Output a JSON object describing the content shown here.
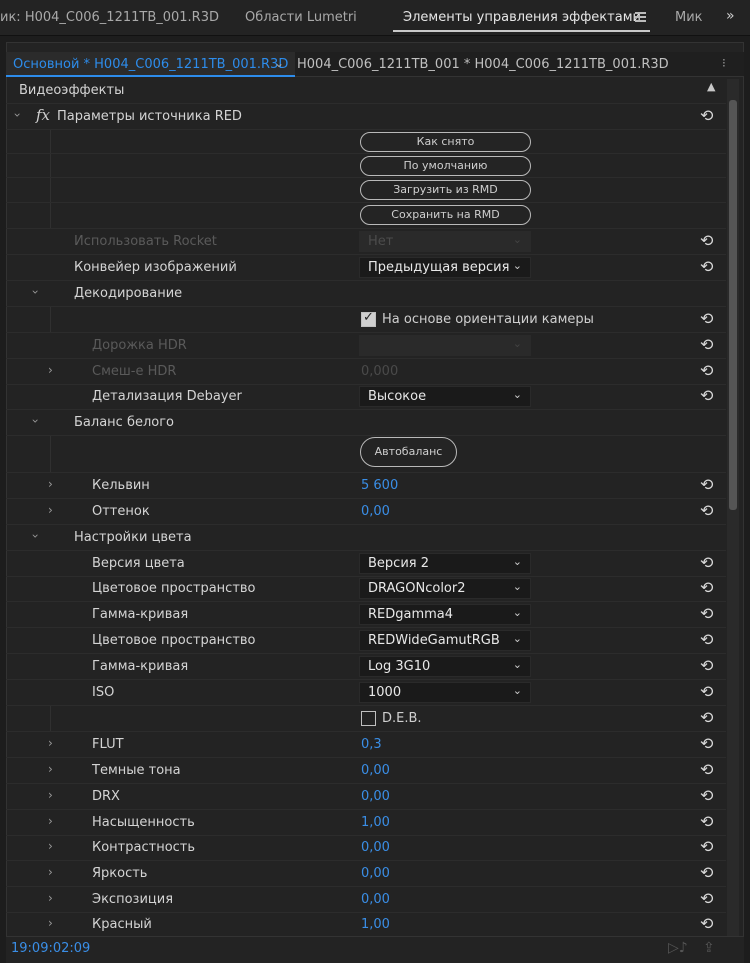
{
  "tabs": {
    "source": "ик: H004_C006_1211TB_001.R3D",
    "lumetri": "Области Lumetri",
    "effect_controls": "Элементы управления эффектами",
    "mixer": "Мик",
    "overflow": "»"
  },
  "clipbar": {
    "master": "Основной * H004_C006_1211TB_001.R3D",
    "chevron": "⌄",
    "sequence_clip": "H004_C006_1211TB_001 * H004_C006_1211TB_001.R3D"
  },
  "video_effects_header": "Видеоэффекты",
  "red_source": {
    "fx": "fx",
    "title": "Параметры источника RED",
    "buttons": [
      "Как снято",
      "По умолчанию",
      "Загрузить из RMD",
      "Сохранить на RMD"
    ],
    "use_rocket": {
      "label": "Использовать Rocket",
      "value": "Нет"
    },
    "pipeline": {
      "label": "Конвейер изображений",
      "value": "Предыдущая версия"
    },
    "decode": {
      "title": "Декодирование",
      "camera_orientation": {
        "label": "На основе ориентации камеры",
        "checked": true
      },
      "hdr_track": {
        "label": "Дорожка HDR",
        "value": ""
      },
      "hdr_blend": {
        "label": "Смеш-е HDR",
        "value": "0,000"
      },
      "debayer": {
        "label": "Детализация Debayer",
        "value": "Высокое"
      }
    },
    "white_balance": {
      "title": "Баланс белого",
      "auto_button": "Автобаланс",
      "kelvin": {
        "label": "Кельвин",
        "value": "5 600"
      },
      "tint": {
        "label": "Оттенок",
        "value": "0,00"
      }
    },
    "color_settings": {
      "title": "Настройки цвета",
      "color_version": {
        "label": "Версия цвета",
        "value": "Версия 2"
      },
      "color_space_1": {
        "label": "Цветовое пространство",
        "value": "DRAGONcolor2"
      },
      "gamma_1": {
        "label": "Гамма-кривая",
        "value": "REDgamma4"
      },
      "color_space_2": {
        "label": "Цветовое пространство",
        "value": "REDWideGamutRGB"
      },
      "gamma_2": {
        "label": "Гамма-кривая",
        "value": "Log 3G10"
      },
      "iso": {
        "label": "ISO",
        "value": "1000"
      },
      "deb": {
        "label": "D.E.B.",
        "checked": false
      },
      "flut": {
        "label": "FLUT",
        "value": "0,3"
      },
      "shadows": {
        "label": "Темные тона",
        "value": "0,00"
      },
      "drx": {
        "label": "DRX",
        "value": "0,00"
      },
      "saturation": {
        "label": "Насыщенность",
        "value": "1,00"
      },
      "contrast": {
        "label": "Контрастность",
        "value": "0,00"
      },
      "brightness": {
        "label": "Яркость",
        "value": "0,00"
      },
      "exposure": {
        "label": "Экспозиция",
        "value": "0,00"
      },
      "red": {
        "label": "Красный",
        "value": "1,00"
      }
    }
  },
  "footer": {
    "timecode": "19:09:02:09"
  },
  "icons": {
    "reset": "reset-icon",
    "chevron": "chevron-right-icon",
    "dropdown": "chevron-down-icon"
  },
  "colors": {
    "accent": "#3a8ee6",
    "panel_bg": "#232323"
  }
}
